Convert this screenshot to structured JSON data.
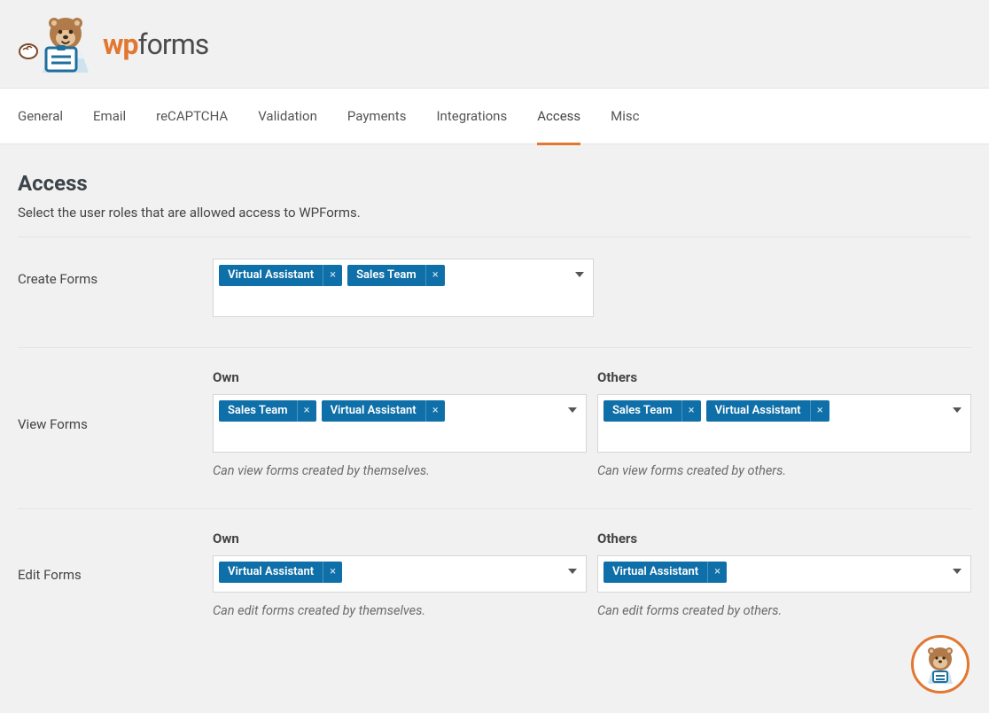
{
  "brand": {
    "wp": "wp",
    "forms": "forms"
  },
  "tabs": [
    {
      "label": "General",
      "active": false
    },
    {
      "label": "Email",
      "active": false
    },
    {
      "label": "reCAPTCHA",
      "active": false
    },
    {
      "label": "Validation",
      "active": false
    },
    {
      "label": "Payments",
      "active": false
    },
    {
      "label": "Integrations",
      "active": false
    },
    {
      "label": "Access",
      "active": true
    },
    {
      "label": "Misc",
      "active": false
    }
  ],
  "page": {
    "title": "Access",
    "subtitle": "Select the user roles that are allowed access to WPForms."
  },
  "sections": {
    "create": {
      "label": "Create Forms",
      "selected": [
        "Virtual Assistant",
        "Sales Team"
      ]
    },
    "view": {
      "label": "View Forms",
      "own": {
        "heading": "Own",
        "selected": [
          "Sales Team",
          "Virtual Assistant"
        ],
        "helper": "Can view forms created by themselves."
      },
      "others": {
        "heading": "Others",
        "selected": [
          "Sales Team",
          "Virtual Assistant"
        ],
        "helper": "Can view forms created by others."
      }
    },
    "edit": {
      "label": "Edit Forms",
      "own": {
        "heading": "Own",
        "selected": [
          "Virtual Assistant"
        ],
        "helper": "Can edit forms created by themselves."
      },
      "others": {
        "heading": "Others",
        "selected": [
          "Virtual Assistant"
        ],
        "helper": "Can edit forms created by others."
      }
    }
  }
}
